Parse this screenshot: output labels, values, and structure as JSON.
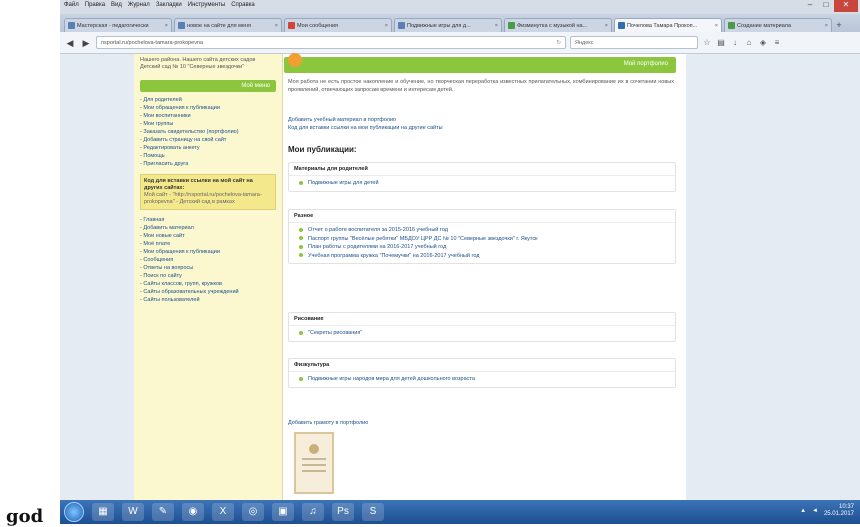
{
  "overlay_text": "god",
  "browser": {
    "menu": [
      "Файл",
      "Правка",
      "Вид",
      "Журнал",
      "Закладки",
      "Инструменты",
      "Справка"
    ],
    "tabs": [
      {
        "label": "Мастерская - педагогически",
        "active": false
      },
      {
        "label": "новое на сайте для меня",
        "active": false
      },
      {
        "label": "Мои сообщения",
        "active": false
      },
      {
        "label": "Подвижные игры для д...",
        "active": false
      },
      {
        "label": "Физминутка с музыкой на...",
        "active": false
      },
      {
        "label": "Почелова Тамара Прокоп...",
        "active": true
      },
      {
        "label": "Создание материала",
        "active": false
      }
    ],
    "url": "nsportal.ru/pochelova-tamara-prokopevna",
    "search_placeholder": "Яндекс"
  },
  "sidebar": {
    "intro": "Нашего района. Нашего сайта детских садов Детский сад № 10 \"Северные звездочки\"",
    "section_title": "Моё меню",
    "items": [
      "Для родителей",
      "Мои обращения к публикации",
      "Мои воспитанники",
      "Мои группы",
      "Заказать свидетельство (портфолио)",
      "Добавить страницу на свой сайт",
      "Редактировать анкету",
      "Помощь",
      "Пригласить друга"
    ],
    "code_title": "Код для вставки ссылки на мой сайт на других сайтах:",
    "code_text": "Мой сайт - \"http://nsportal.ru/pochelova-tamara-prokopevna\" - Детский сад в рамках",
    "items2": [
      "Главная",
      "Добавить материал",
      "Мои новые сайт",
      "Моё плате",
      "Мои обращения к публикации",
      "Сообщения",
      "Ответы на вопросы",
      "Поиск по сайту",
      "Сайты классов, групп, кружков",
      "Сайты образовательных учреждений",
      "Сайты пользователей"
    ]
  },
  "main": {
    "header_label": "Мой портфолио",
    "description": "Моя работа не есть простое накопление и обучение, но творческая переработка известных прилагательных, комбинирование их в сочетании новых проявлений, отвечающих запросам времени и интересам детей.",
    "links": [
      "Добавить учебный материал в портфолио",
      "Код для вставки ссылки на мои публикации на другие сайты"
    ],
    "publications_title": "Мои публикации:",
    "sections": [
      {
        "title": "Материалы для родителей",
        "items": [
          "Подвижные игры для детей"
        ]
      },
      {
        "title": "Разное",
        "items": [
          "Отчет о работе воспитателя за 2015-2016 учебный год",
          "Паспорт группы \"Весёлые ребятки\" МБДОУ ЦРР ДС № 10 \"Северные звездочки\" г. Якутск",
          "План работы с родителями на 2016-2017 учебный год",
          "Учебная программа кружка \"Почемучки\" на 2016-2017 учебный год"
        ]
      },
      {
        "title": "Рисование",
        "items": [
          "\"Секреты рисования\""
        ]
      },
      {
        "title": "Физкультура",
        "items": [
          "Подвижные игры народов мира для детей дошкольного возраста"
        ]
      }
    ],
    "add_certificate": "Добавить грамоту в портфолио"
  },
  "taskbar": {
    "apps": [
      "explorer",
      "word",
      "paint",
      "firefox",
      "excel",
      "cam",
      "files",
      "media",
      "photoshop",
      "skype"
    ],
    "time": "10:37",
    "date": "25.01.2017"
  }
}
